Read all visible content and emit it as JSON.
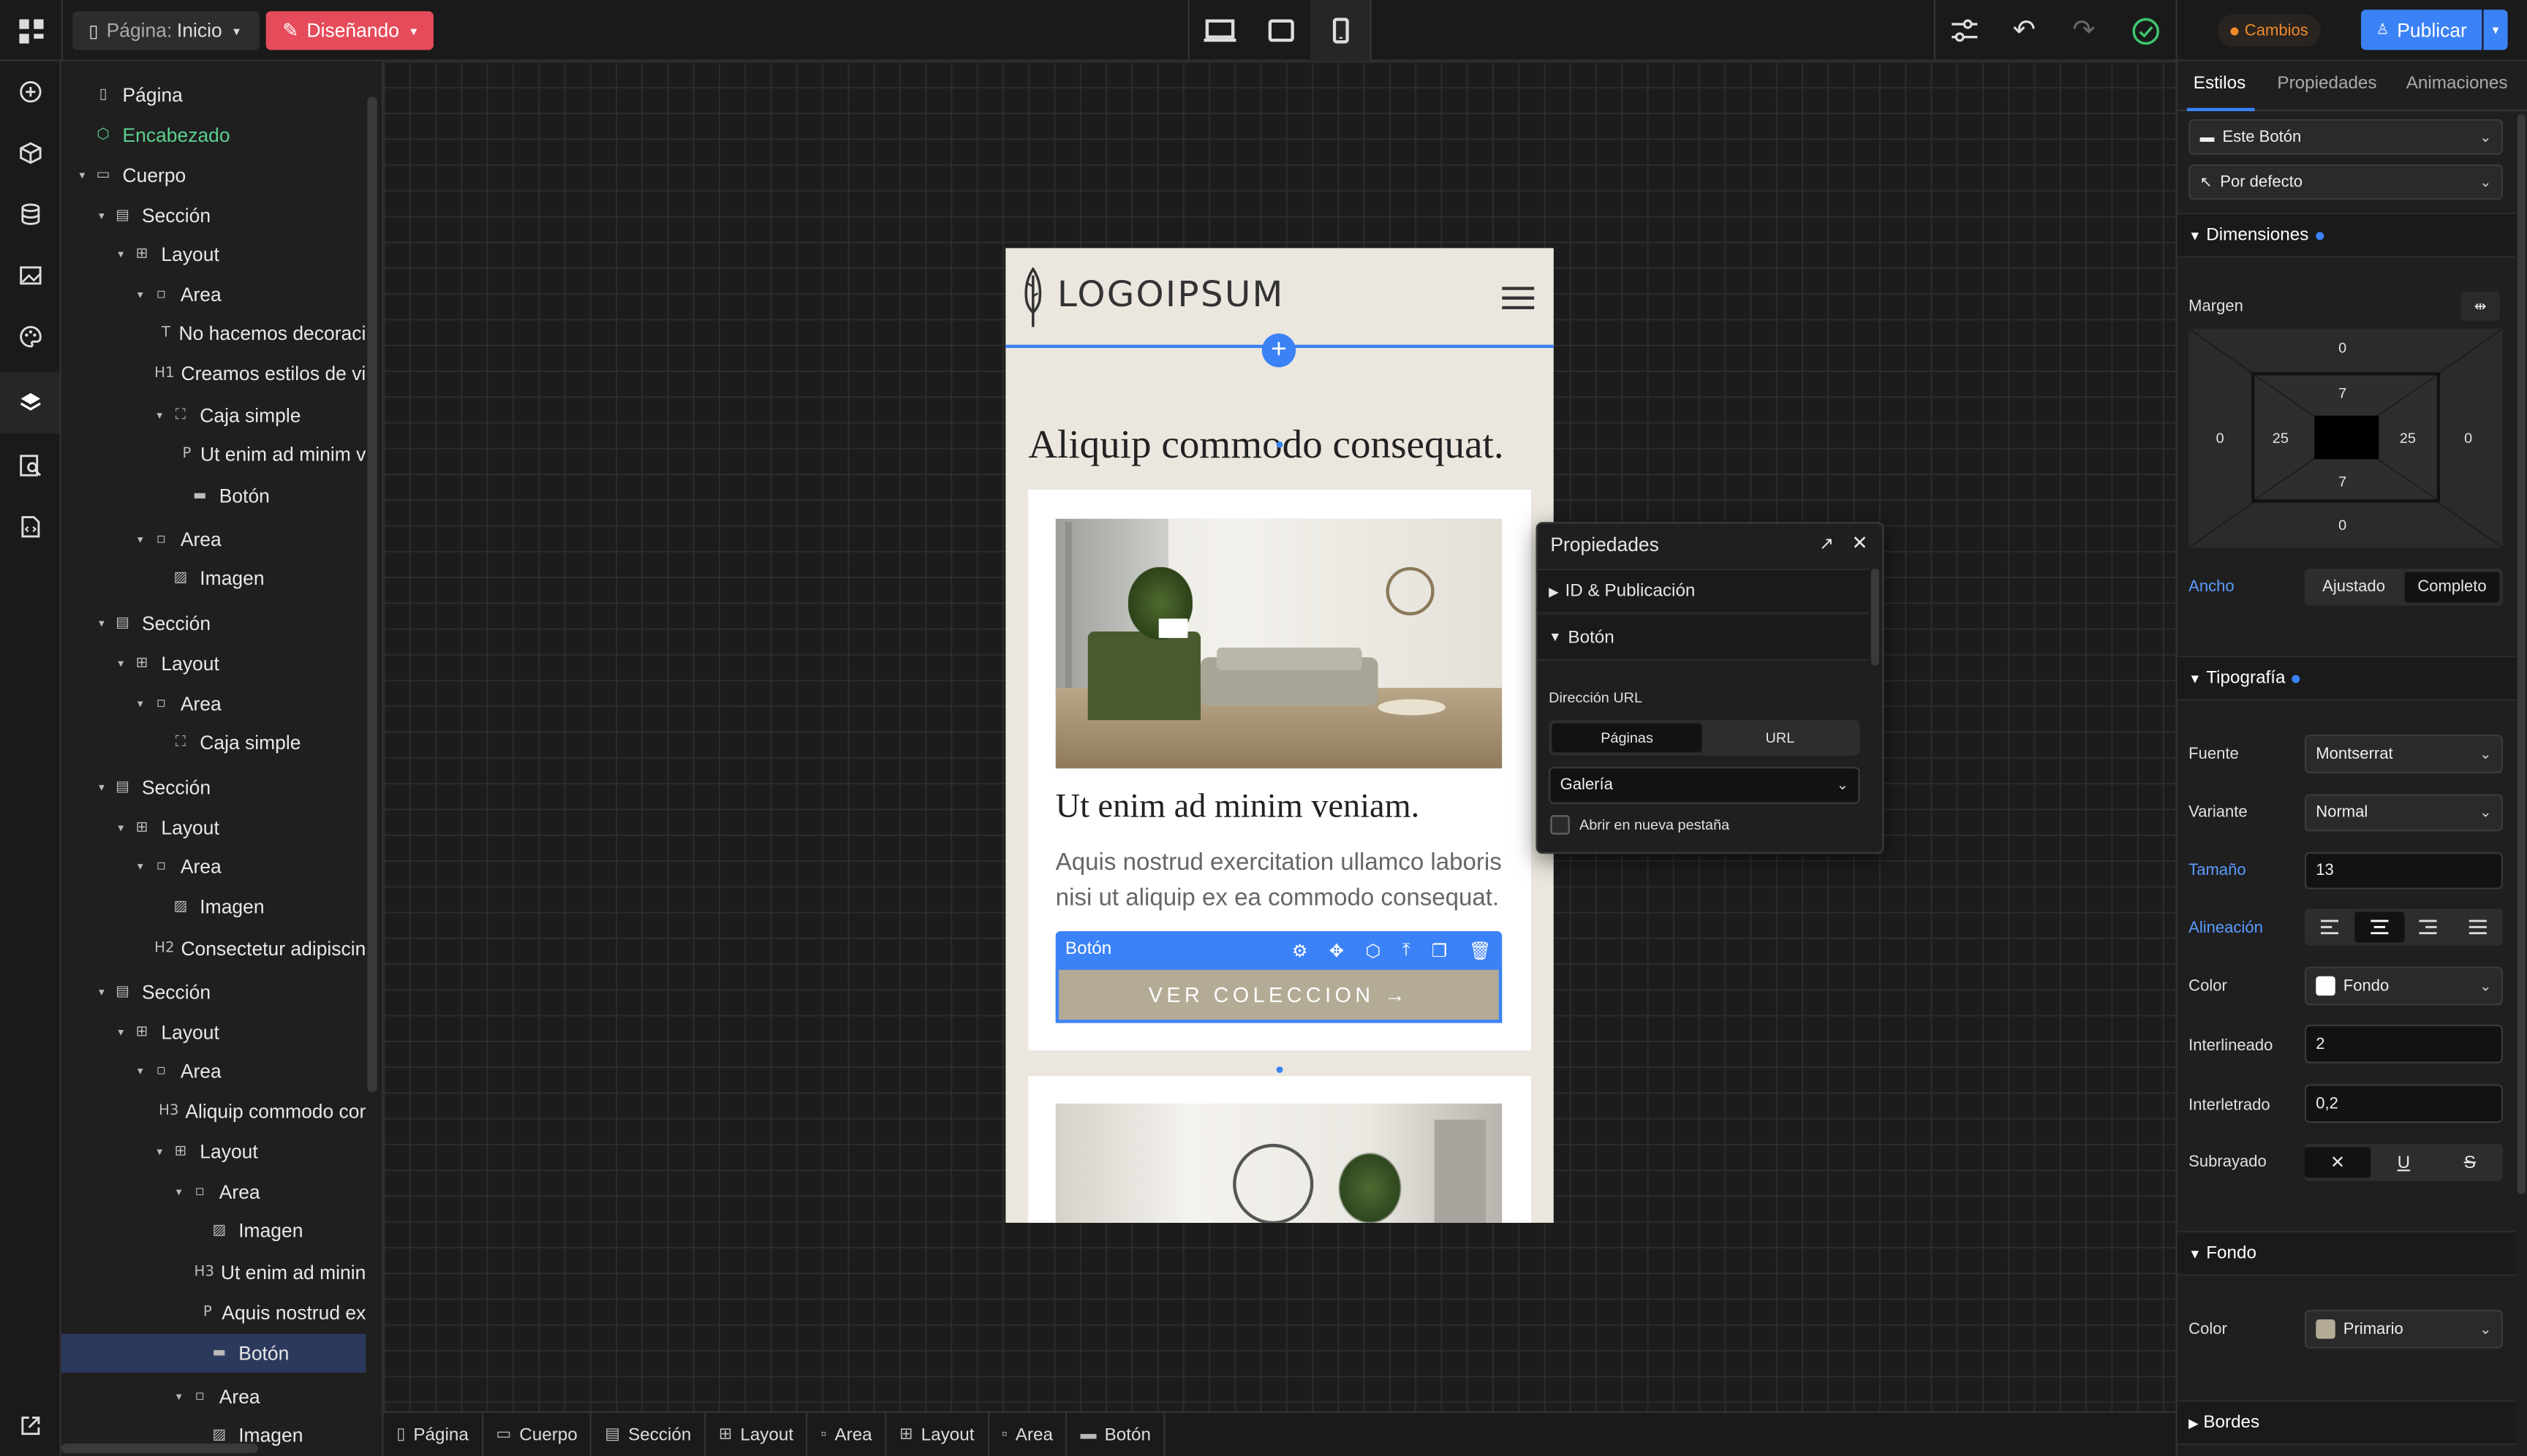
{
  "topbar": {
    "page_label": "Página:",
    "page_name": "Inicio",
    "mode_label": "Diseñando",
    "changes_label": "Cambios",
    "publish_label": "Publicar"
  },
  "navigator": [
    {
      "label": "Página",
      "icon": "page-icon",
      "depth": 0,
      "caret": "",
      "glyph": "▯"
    },
    {
      "label": "Encabezado",
      "icon": "component-icon",
      "depth": 0,
      "caret": "",
      "glyph": "⬡",
      "green": true
    },
    {
      "label": "Cuerpo",
      "icon": "body-icon",
      "depth": 0,
      "caret": "▾",
      "glyph": "▭"
    },
    {
      "label": "Sección",
      "icon": "section-icon",
      "depth": 1,
      "caret": "▾",
      "glyph": "▤"
    },
    {
      "label": "Layout",
      "icon": "layout-icon",
      "depth": 2,
      "caret": "▾",
      "glyph": "⊞"
    },
    {
      "label": "Area",
      "icon": "area-icon",
      "depth": 3,
      "caret": "▾",
      "glyph": "▫"
    },
    {
      "label": "No hacemos decoraci",
      "icon": "text-icon",
      "depth": 4,
      "caret": "",
      "glyph": "T"
    },
    {
      "label": "Creamos estilos de vi",
      "icon": "heading-icon",
      "depth": 4,
      "caret": "",
      "glyph": "H1"
    },
    {
      "label": "Caja simple",
      "icon": "box-icon",
      "depth": 4,
      "caret": "▾",
      "glyph": "⛶"
    },
    {
      "label": "Ut enim ad minim v",
      "icon": "paragraph-icon",
      "depth": 5,
      "caret": "",
      "glyph": "P"
    },
    {
      "label": "Botón",
      "icon": "button-icon",
      "depth": 5,
      "caret": "",
      "glyph": "▬"
    },
    {
      "label": "Area",
      "icon": "area-icon",
      "depth": 3,
      "caret": "▾",
      "glyph": "▫"
    },
    {
      "label": "Imagen",
      "icon": "image-icon",
      "depth": 4,
      "caret": "",
      "glyph": "▨"
    },
    {
      "label": "Sección",
      "icon": "section-icon",
      "depth": 1,
      "caret": "▾",
      "glyph": "▤"
    },
    {
      "label": "Layout",
      "icon": "layout-icon",
      "depth": 2,
      "caret": "▾",
      "glyph": "⊞"
    },
    {
      "label": "Area",
      "icon": "area-icon",
      "depth": 3,
      "caret": "▾",
      "glyph": "▫"
    },
    {
      "label": "Caja simple",
      "icon": "box-icon",
      "depth": 4,
      "caret": "",
      "glyph": "⛶"
    },
    {
      "label": "Sección",
      "icon": "section-icon",
      "depth": 1,
      "caret": "▾",
      "glyph": "▤"
    },
    {
      "label": "Layout",
      "icon": "layout-icon",
      "depth": 2,
      "caret": "▾",
      "glyph": "⊞"
    },
    {
      "label": "Area",
      "icon": "area-icon",
      "depth": 3,
      "caret": "▾",
      "glyph": "▫"
    },
    {
      "label": "Imagen",
      "icon": "image-icon",
      "depth": 4,
      "caret": "",
      "glyph": "▨"
    },
    {
      "label": "Consectetur adipiscin",
      "icon": "heading-icon",
      "depth": 4,
      "caret": "",
      "glyph": "H2"
    },
    {
      "label": "Sección",
      "icon": "section-icon",
      "depth": 1,
      "caret": "▾",
      "glyph": "▤"
    },
    {
      "label": "Layout",
      "icon": "layout-icon",
      "depth": 2,
      "caret": "▾",
      "glyph": "⊞"
    },
    {
      "label": "Area",
      "icon": "area-icon",
      "depth": 3,
      "caret": "▾",
      "glyph": "▫"
    },
    {
      "label": "Aliquip commodo cor",
      "icon": "heading-icon",
      "depth": 4,
      "caret": "",
      "glyph": "H3"
    },
    {
      "label": "Layout",
      "icon": "layout-icon",
      "depth": 4,
      "caret": "▾",
      "glyph": "⊞"
    },
    {
      "label": "Area",
      "icon": "area-icon",
      "depth": 5,
      "caret": "▾",
      "glyph": "▫"
    },
    {
      "label": "Imagen",
      "icon": "image-icon",
      "depth": 6,
      "caret": "",
      "glyph": "▨"
    },
    {
      "label": "Ut enim ad minin",
      "icon": "heading-icon",
      "depth": 6,
      "caret": "",
      "glyph": "H3"
    },
    {
      "label": "Aquis nostrud ex",
      "icon": "paragraph-icon",
      "depth": 6,
      "caret": "",
      "glyph": "P"
    },
    {
      "label": "Botón",
      "icon": "button-icon",
      "depth": 6,
      "caret": "",
      "glyph": "▬",
      "selected": true
    },
    {
      "label": "Area",
      "icon": "area-icon",
      "depth": 5,
      "caret": "▾",
      "glyph": "▫"
    },
    {
      "label": "Imagen",
      "icon": "image-icon",
      "depth": 6,
      "caret": "",
      "glyph": "▨"
    }
  ],
  "page": {
    "logo_text": "LOGOIPSUM",
    "heading": "Aliquip commodo consequat.",
    "card_title": "Ut enim ad minim veniam.",
    "card_text": "Aquis nostrud exercitation ullamco laboris nisi ut aliquip ex ea commodo consequat.",
    "button_text": "VER COLECCION →",
    "selected_tag": "Botón"
  },
  "breadcrumb": [
    "Página",
    "Cuerpo",
    "Sección",
    "Layout",
    "Area",
    "Layout",
    "Area",
    "Botón"
  ],
  "props_popup": {
    "title": "Propiedades",
    "id_section": "ID & Publicación",
    "button_section": "Botón",
    "url_label": "Dirección URL",
    "tab_pages": "Páginas",
    "tab_url": "URL",
    "select_value": "Galería",
    "new_tab_label": "Abrir en nueva pestaña"
  },
  "right_panel": {
    "tabs": [
      "Estilos",
      "Propiedades",
      "Animaciones"
    ],
    "target": "Este Botón",
    "state": "Por defecto",
    "dimensions": "Dimensiones",
    "margin_label": "Margen",
    "margin": {
      "top": "0",
      "right": "0",
      "bottom": "0",
      "left": "0"
    },
    "padding": {
      "top": "7",
      "right": "25",
      "bottom": "7",
      "left": "25"
    },
    "width_label": "Ancho",
    "width_opt1": "Ajustado",
    "width_opt2": "Completo",
    "typography": "Tipografía",
    "font_label": "Fuente",
    "font_value": "Montserrat",
    "variant_label": "Variante",
    "variant_value": "Normal",
    "size_label": "Tamaño",
    "size_value": "13",
    "align_label": "Alineación",
    "color_label": "Color",
    "color_value": "Fondo",
    "line_label": "Interlineado",
    "line_value": "2",
    "spacing_label": "Interletrado",
    "spacing_value": "0,2",
    "underline_label": "Subrayado",
    "background": "Fondo",
    "bg_color_label": "Color",
    "bg_color_value": "Primario",
    "borders": "Bordes"
  },
  "colors": {
    "accent": "#3b82f6",
    "publish": "#3b82f6",
    "mode": "#e54b5a",
    "cambios": "#f08a2c",
    "button_bg": "#b3ab96",
    "page_bg": "#ebe7df"
  }
}
